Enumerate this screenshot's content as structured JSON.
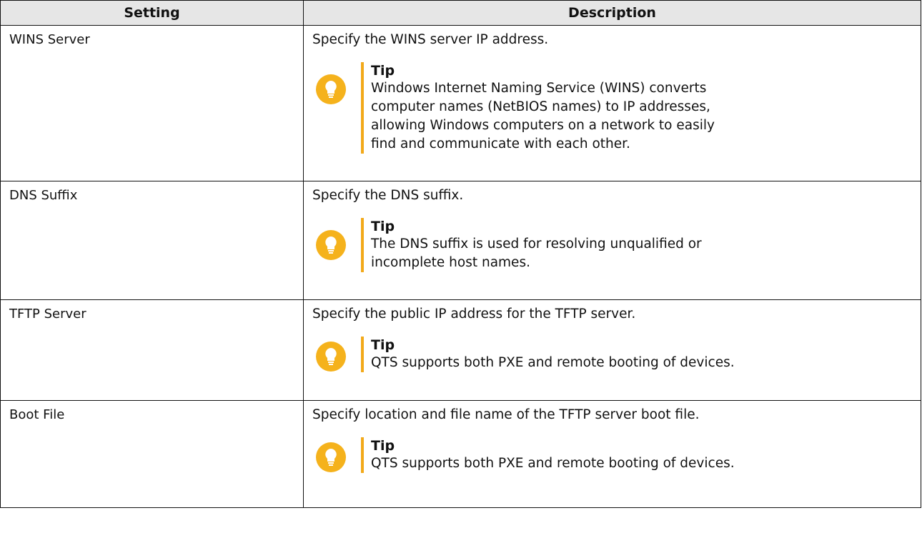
{
  "headers": {
    "setting": "Setting",
    "description": "Description"
  },
  "rows": [
    {
      "setting": "WINS Server",
      "description": "Specify the WINS server IP address.",
      "tip_title": "Tip",
      "tip_lines": [
        "Windows Internet Naming Service (WINS) converts",
        "computer names (NetBIOS names) to IP addresses,",
        "allowing Windows computers on a network to easily",
        "find and communicate with each other."
      ]
    },
    {
      "setting": "DNS Suffix",
      "description": "Specify the DNS suffix.",
      "tip_title": "Tip",
      "tip_lines": [
        "The DNS suffix is used for resolving unqualified or",
        "incomplete host names."
      ]
    },
    {
      "setting": "TFTP Server",
      "description": "Specify the public IP address for the TFTP server.",
      "tip_title": "Tip",
      "tip_lines": [
        "QTS supports both PXE and remote booting of devices."
      ]
    },
    {
      "setting": "Boot File",
      "description": "Specify location and file name of the TFTP server boot file.",
      "tip_title": "Tip",
      "tip_lines": [
        "QTS supports both PXE and remote booting of devices."
      ]
    }
  ],
  "colors": {
    "header_bg": "#e6e6e6",
    "border": "#111111",
    "tip_accent": "#f2a91a",
    "tip_icon": "#f5b21c"
  },
  "icons": {
    "tip": "lightbulb-icon"
  }
}
